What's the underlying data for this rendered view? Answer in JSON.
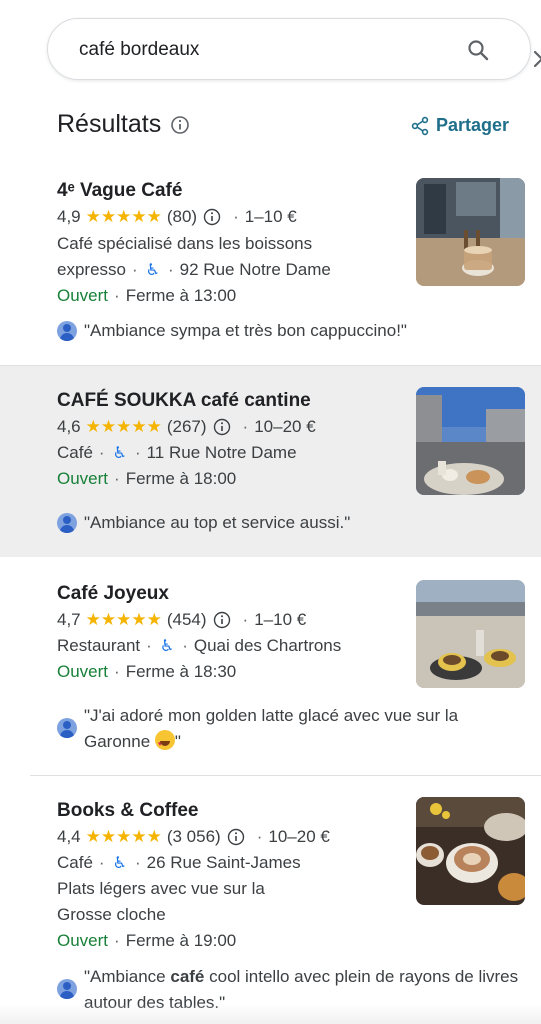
{
  "search": {
    "query": "café bordeaux"
  },
  "header": {
    "title": "Résultats",
    "share_label": "Partager"
  },
  "results": [
    {
      "name": "4ᵉ Vague Café",
      "rating": "4,9",
      "stars": "★★★★★",
      "reviews": "(80)",
      "price": "1–10 €",
      "category_line1": "Café spécialisé dans les boissons",
      "category_line2": "expresso",
      "address": "92 Rue Notre Dame",
      "status": "Ouvert",
      "hours": "Ferme à 13:00",
      "review": "\"Ambiance sympa et très bon cappuccino!\""
    },
    {
      "name": "CAFÉ SOUKKA café cantine",
      "rating": "4,6",
      "stars": "★★★★★",
      "reviews": "(267)",
      "price": "10–20 €",
      "category": "Café",
      "address": "11 Rue Notre Dame",
      "status": "Ouvert",
      "hours": "Ferme à 18:00",
      "review": "\"Ambiance au top et service aussi.\""
    },
    {
      "name": "Café Joyeux",
      "rating": "4,7",
      "stars": "★★★★★",
      "reviews": "(454)",
      "price": "1–10 €",
      "category": "Restaurant",
      "address": "Quai des Chartrons",
      "status": "Ouvert",
      "hours": "Ferme à 18:30",
      "review_line1": "\"J'ai adoré mon golden latte glacé avec vue sur la",
      "review_line2": "Garonne",
      "review_end": "\""
    },
    {
      "name": "Books & Coffee",
      "rating": "4,4",
      "stars": "★★★★★",
      "reviews": "(3 056)",
      "price": "10–20 €",
      "category": "Café",
      "address": "26 Rue Saint-James",
      "description_line1": "Plats légers avec vue sur la",
      "description_line2": "Grosse cloche",
      "status": "Ouvert",
      "hours": "Ferme à 19:00",
      "review_pre": "\"Ambiance ",
      "review_bold": "café",
      "review_post": " cool intello avec plein de rayons de livres autour des tables.\""
    }
  ],
  "separator": "·",
  "colors": {
    "open": "#188038",
    "star": "#f5b400",
    "accent": "#1a73e8",
    "highlight": "#eeeeee"
  }
}
